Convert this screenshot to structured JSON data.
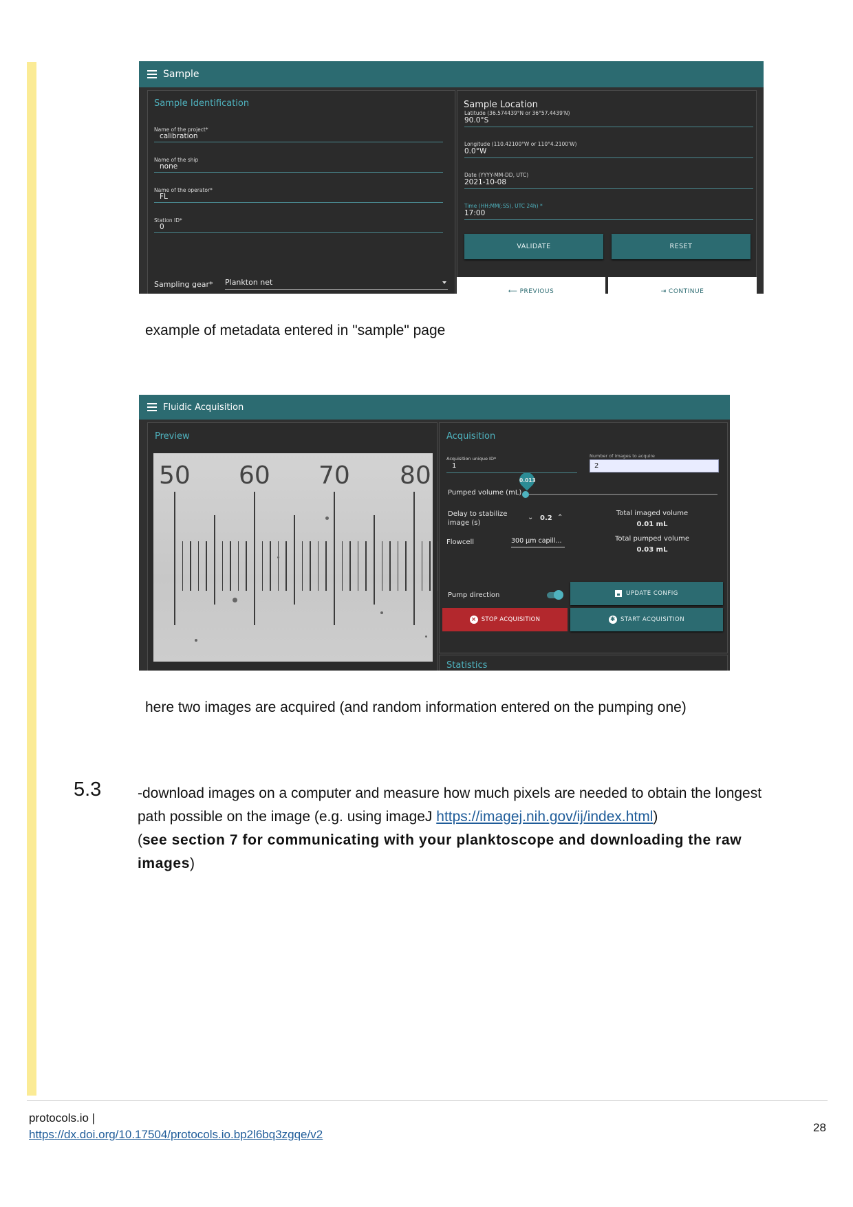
{
  "screenshot1": {
    "title": "Sample",
    "identification": {
      "heading": "Sample Identification",
      "fields": [
        {
          "label": "Name of the project*",
          "value": "calibration"
        },
        {
          "label": "Name of the ship",
          "value": "none"
        },
        {
          "label": "Name of the operator*",
          "value": "FL"
        },
        {
          "label": "Station ID*",
          "value": "0"
        }
      ],
      "gear_label": "Sampling gear*",
      "gear_value": "Plankton net"
    },
    "location": {
      "heading": "Sample Location",
      "fields": [
        {
          "label": "Latitude (36.574439°N or 36°57.4439'N)",
          "value": "90.0°S"
        },
        {
          "label": "Longitude (110.42100°W or 110°4.2100'W)",
          "value": "0.0°W"
        },
        {
          "label": "Date (YYYY-MM-DD, UTC)",
          "value": "2021-10-08"
        },
        {
          "label": "Time (HH:MM(:SS), UTC 24h) *",
          "value": "17:00"
        }
      ],
      "validate": "VALIDATE",
      "reset": "RESET",
      "previous": "⟵ PREVIOUS",
      "continue": "⇥ CONTINUE"
    }
  },
  "caption1": "example of metadata entered in \"sample\" page",
  "screenshot2": {
    "title": "Fluidic Acquisition",
    "preview_heading": "Preview",
    "ruler_numbers": [
      "50",
      "60",
      "70",
      "80"
    ],
    "acquisition_heading": "Acquisition",
    "uid_label": "Acquisition unique ID*",
    "uid_value": "1",
    "images_label": "Number of images to acquire",
    "images_value": "2",
    "pumped_label": "Pumped volume (mL)",
    "pumped_value": "0.013",
    "delay_label_1": "Delay to stabilize",
    "delay_label_2": "image (s)",
    "delay_value": "0.2",
    "total_imaged_label": "Total imaged volume",
    "total_imaged_value": "0.01 mL",
    "flowcell_label": "Flowcell",
    "flowcell_value": "300 µm capill...",
    "total_pumped_label": "Total pumped volume",
    "total_pumped_value": "0.03 mL",
    "pump_direction_label": "Pump direction",
    "update_config": "UPDATE CONFIG",
    "stop_acquisition": "STOP ACQUISITION",
    "start_acquisition": "START ACQUISITION",
    "statistics_heading": "Statistics"
  },
  "caption2": "here two images are acquired (and random information entered on the pumping one)",
  "step": {
    "number": "5.3",
    "text_1": "-download images on a computer and measure how much pixels are needed to obtain the longest path possible on the image (e.g. using imageJ ",
    "link": "https://imagej.nih.gov/ij/index.html",
    "text_2": ")",
    "paren_open": "(",
    "bold_s": "s",
    "bold_rest": "ee section 7 for communicating with your planktoscope and downloading the raw images",
    "paren_close": ")"
  },
  "footer": {
    "site": "protocols.io |",
    "doi": "https://dx.doi.org/10.17504/protocols.io.bp2l6bq3zgqe/v2",
    "page": "28"
  },
  "colors": {
    "teal": "#2c6b71",
    "accent_text": "#4fb3bf",
    "stop_red": "#b3282d",
    "margin_bar": "#fbeb95"
  }
}
